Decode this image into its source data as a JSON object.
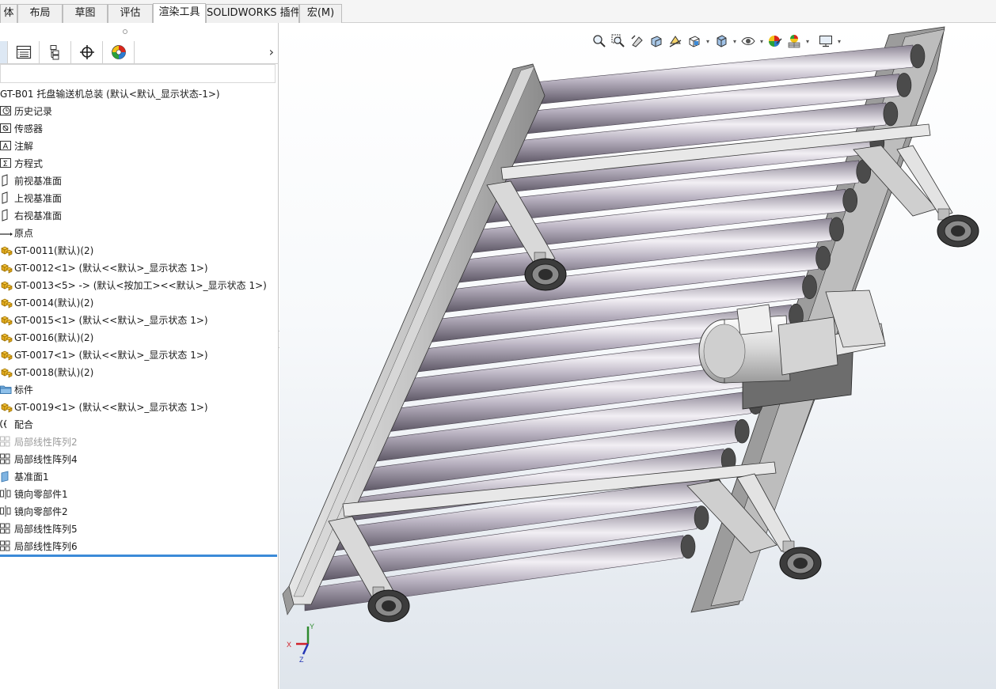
{
  "command_tabs": [
    {
      "label": "体",
      "active": false
    },
    {
      "label": "布局",
      "active": false
    },
    {
      "label": "草图",
      "active": false
    },
    {
      "label": "评估",
      "active": false
    },
    {
      "label": "渲染工具",
      "active": true
    },
    {
      "label": "SOLIDWORKS 插件",
      "active": false
    },
    {
      "label": "宏(M)",
      "active": false
    }
  ],
  "panel_tabs": [
    {
      "icon": "feature-tree-icon"
    },
    {
      "icon": "property-manager-icon"
    },
    {
      "icon": "configuration-manager-icon"
    },
    {
      "icon": "dimxpert-icon"
    },
    {
      "icon": "display-manager-icon"
    }
  ],
  "tree": {
    "root": "GT-B01 托盘输送机总装  (默认<默认_显示状态-1>)",
    "items": [
      {
        "label": "历史记录",
        "icon": "history-icon",
        "dim": false
      },
      {
        "label": "传感器",
        "icon": "sensor-icon",
        "dim": false
      },
      {
        "label": "注解",
        "icon": "annotation-icon",
        "dim": false
      },
      {
        "label": "方程式",
        "icon": "equation-icon",
        "dim": false
      },
      {
        "label": "前视基准面",
        "icon": "plane-icon",
        "dim": false
      },
      {
        "label": "上视基准面",
        "icon": "plane-icon",
        "dim": false
      },
      {
        "label": "右视基准面",
        "icon": "plane-icon",
        "dim": false
      },
      {
        "label": "原点",
        "icon": "origin-icon",
        "dim": false
      },
      {
        "label": "GT-0011(默认)(2)",
        "icon": "assembly-icon",
        "dim": false
      },
      {
        "label": "GT-0012<1> (默认<<默认>_显示状态 1>)",
        "icon": "assembly-icon",
        "dim": false
      },
      {
        "label": "GT-0013<5> -> (默认<按加工><<默认>_显示状态 1>)",
        "icon": "assembly-icon",
        "dim": false
      },
      {
        "label": "GT-0014(默认)(2)",
        "icon": "assembly-icon",
        "dim": false
      },
      {
        "label": "GT-0015<1> (默认<<默认>_显示状态 1>)",
        "icon": "assembly-icon",
        "dim": false
      },
      {
        "label": "GT-0016(默认)(2)",
        "icon": "assembly-icon",
        "dim": false
      },
      {
        "label": "GT-0017<1> (默认<<默认>_显示状态 1>)",
        "icon": "assembly-icon",
        "dim": false
      },
      {
        "label": "GT-0018(默认)(2)",
        "icon": "assembly-icon",
        "dim": false
      },
      {
        "label": "标件",
        "icon": "folder-icon",
        "dim": false
      },
      {
        "label": "GT-0019<1> (默认<<默认>_显示状态 1>)",
        "icon": "assembly-icon",
        "dim": false
      },
      {
        "label": "配合",
        "icon": "mates-icon",
        "dim": false
      },
      {
        "label": "局部线性阵列2",
        "icon": "linear-pattern-icon",
        "dim": true
      },
      {
        "label": "局部线性阵列4",
        "icon": "linear-pattern-icon",
        "dim": false
      },
      {
        "label": "基准面1",
        "icon": "plane-solid-icon",
        "dim": false
      },
      {
        "label": "镜向零部件1",
        "icon": "mirror-icon",
        "dim": false
      },
      {
        "label": "镜向零部件2",
        "icon": "mirror-icon",
        "dim": false
      },
      {
        "label": "局部线性阵列5",
        "icon": "linear-pattern-icon",
        "dim": false
      },
      {
        "label": "局部线性阵列6",
        "icon": "linear-pattern-icon",
        "dim": false
      }
    ]
  },
  "hud_tools": [
    {
      "icon": "zoom-to-fit-icon",
      "dropdown": false
    },
    {
      "icon": "zoom-to-area-icon",
      "dropdown": false
    },
    {
      "icon": "previous-view-icon",
      "dropdown": false
    },
    {
      "icon": "section-view-icon",
      "dropdown": false
    },
    {
      "icon": "dynamic-annotation-icon",
      "dropdown": false
    },
    {
      "icon": "view-orientation-icon",
      "dropdown": true
    },
    {
      "icon": "display-style-icon",
      "dropdown": true
    },
    {
      "icon": "hide-show-items-icon",
      "dropdown": true
    },
    {
      "icon": "edit-appearance-icon",
      "dropdown": false
    },
    {
      "icon": "apply-scene-icon",
      "dropdown": true
    },
    {
      "icon": "view-settings-icon",
      "dropdown": true
    }
  ],
  "triad": {
    "x": "X",
    "y": "Y",
    "z": "Z"
  },
  "colors": {
    "roller": "#b5aec0",
    "frame": "#cfcfcf",
    "frame_dark": "#7d7d7d",
    "selection": "#3b8ad8",
    "axis_x": "#d0202a",
    "axis_y": "#2e8a2e",
    "axis_z": "#2436b5"
  }
}
